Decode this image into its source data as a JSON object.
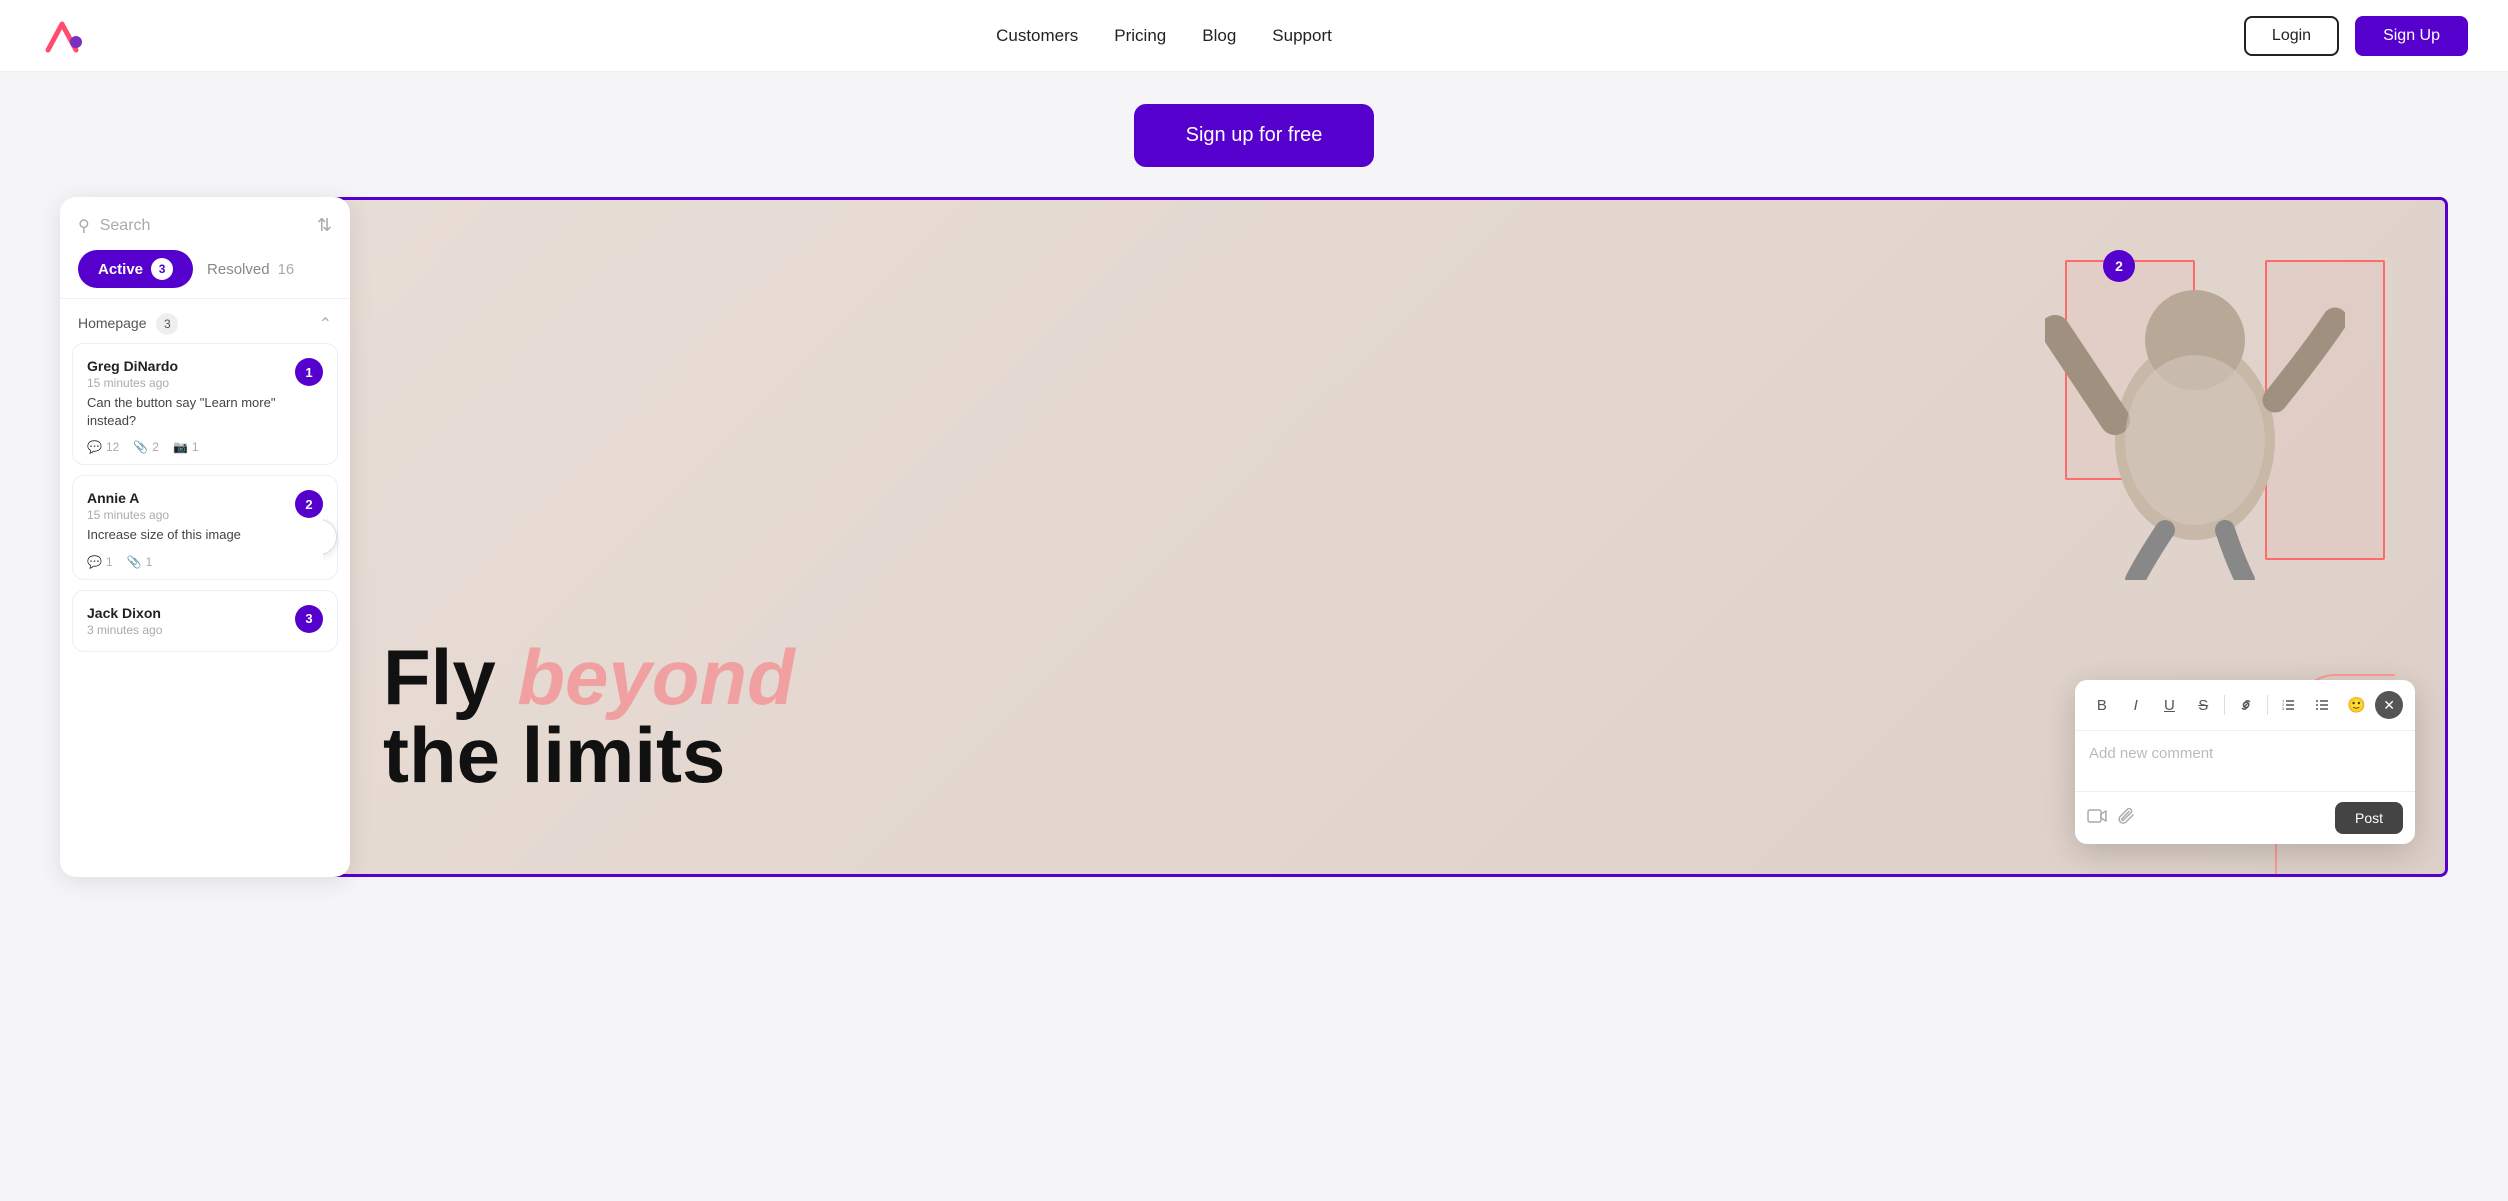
{
  "navbar": {
    "logo_alt": "Markup logo",
    "links": [
      "Customers",
      "Pricing",
      "Blog",
      "Support"
    ],
    "login_label": "Login",
    "signup_label": "Sign Up"
  },
  "hero": {
    "cta_label": "Sign up for free"
  },
  "sidebar": {
    "search_placeholder": "Search",
    "tab_active_label": "Active",
    "tab_active_count": "3",
    "tab_inactive_label": "Resolved",
    "tab_inactive_count": "16",
    "section_label": "Homepage",
    "section_count": "3",
    "comments": [
      {
        "author": "Greg DiNardo",
        "time": "15 minutes ago",
        "text": "Can the button say \"Learn more\" instead?",
        "badge": "1",
        "replies": "12",
        "attachments": "2",
        "images": "1"
      },
      {
        "author": "Annie A",
        "time": "15 minutes ago",
        "text": "Increase size of this image",
        "badge": "2",
        "replies": "1",
        "attachments": "1",
        "images": ""
      },
      {
        "author": "Jack Dixon",
        "time": "3 minutes ago",
        "text": "",
        "badge": "3",
        "replies": "",
        "attachments": "",
        "images": ""
      }
    ]
  },
  "canvas": {
    "badge_number": "2",
    "text_fly": "Fly",
    "text_beyond": "beyond",
    "text_limits": "the limits",
    "toggle_icon": "‹"
  },
  "editor": {
    "placeholder": "Add new comment",
    "post_label": "Post",
    "toolbar": {
      "bold": "B",
      "italic": "I",
      "underline": "U",
      "strikethrough": "S",
      "link": "🔗",
      "ordered_list": "≡",
      "unordered_list": "☰",
      "emoji": "😊",
      "close": "✕"
    },
    "footer_icons": {
      "video": "▭",
      "attachment": "📎"
    }
  }
}
